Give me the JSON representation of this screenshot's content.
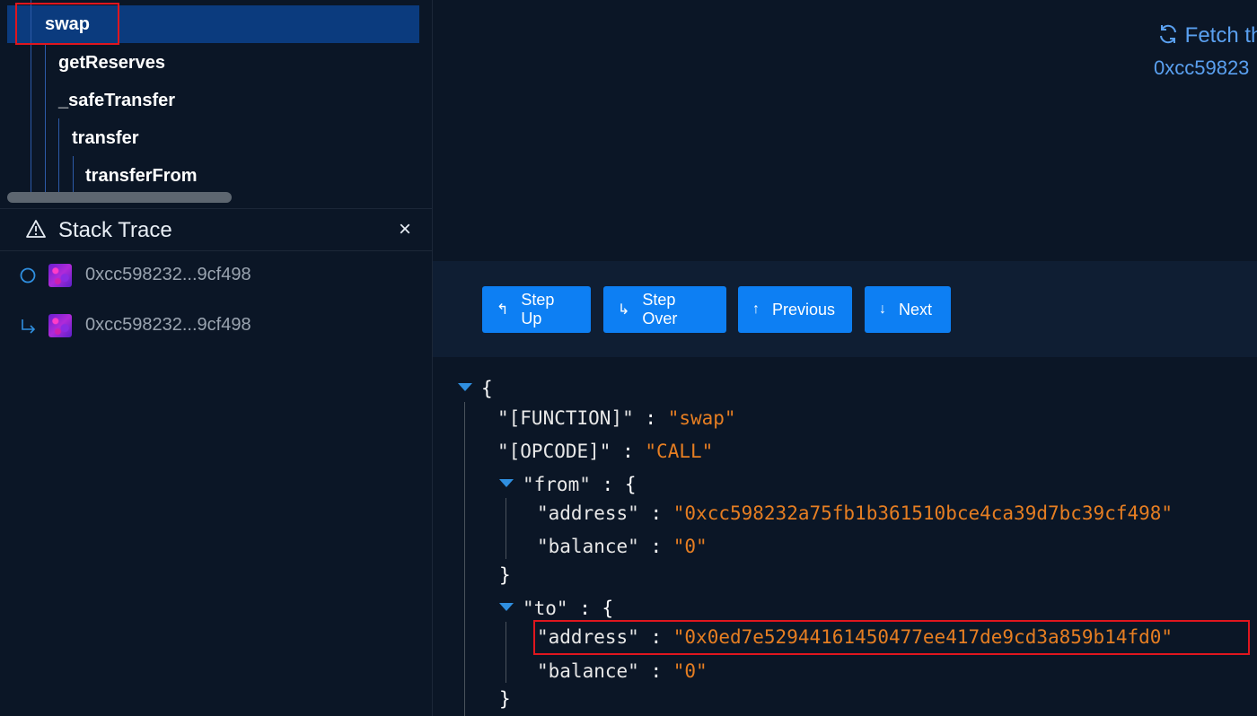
{
  "call_tree": {
    "items": [
      {
        "label": "swap"
      },
      {
        "label": "getReserves"
      },
      {
        "label": "_safeTransfer"
      },
      {
        "label": "transfer"
      },
      {
        "label": "transferFrom"
      }
    ]
  },
  "stack_trace": {
    "title": "Stack Trace",
    "close": "×",
    "rows": [
      {
        "address": "0xcc598232...9cf498"
      },
      {
        "address": "0xcc598232...9cf498"
      }
    ]
  },
  "fetch": {
    "label": "Fetch th",
    "address": "0xcc59823"
  },
  "toolbar": {
    "step_up": "Step Up",
    "step_over": "Step Over",
    "previous": "Previous",
    "next": "Next"
  },
  "json_view": {
    "open_brace": "{",
    "close_brace": "}",
    "function_key": "\"[FUNCTION]\"",
    "function_val": "\"swap\"",
    "opcode_key": "\"[OPCODE]\"",
    "opcode_val": "\"CALL\"",
    "from_key": "\"from\"",
    "from_address_key": "\"address\"",
    "from_address_val": "\"0xcc598232a75fb1b361510bce4ca39d7bc39cf498\"",
    "from_balance_key": "\"balance\"",
    "from_balance_val": "\"0\"",
    "to_key": "\"to\"",
    "to_address_key": "\"address\"",
    "to_address_val": "\"0x0ed7e52944161450477ee417de9cd3a859b14fd0\"",
    "to_balance_key": "\"balance\"",
    "to_balance_val": "\"0\"",
    "colon": ":"
  },
  "colors": {
    "accent": "#0d7ff3",
    "string": "#e67e22",
    "highlight": "#e0161e",
    "selection": "#0b3b7e"
  }
}
